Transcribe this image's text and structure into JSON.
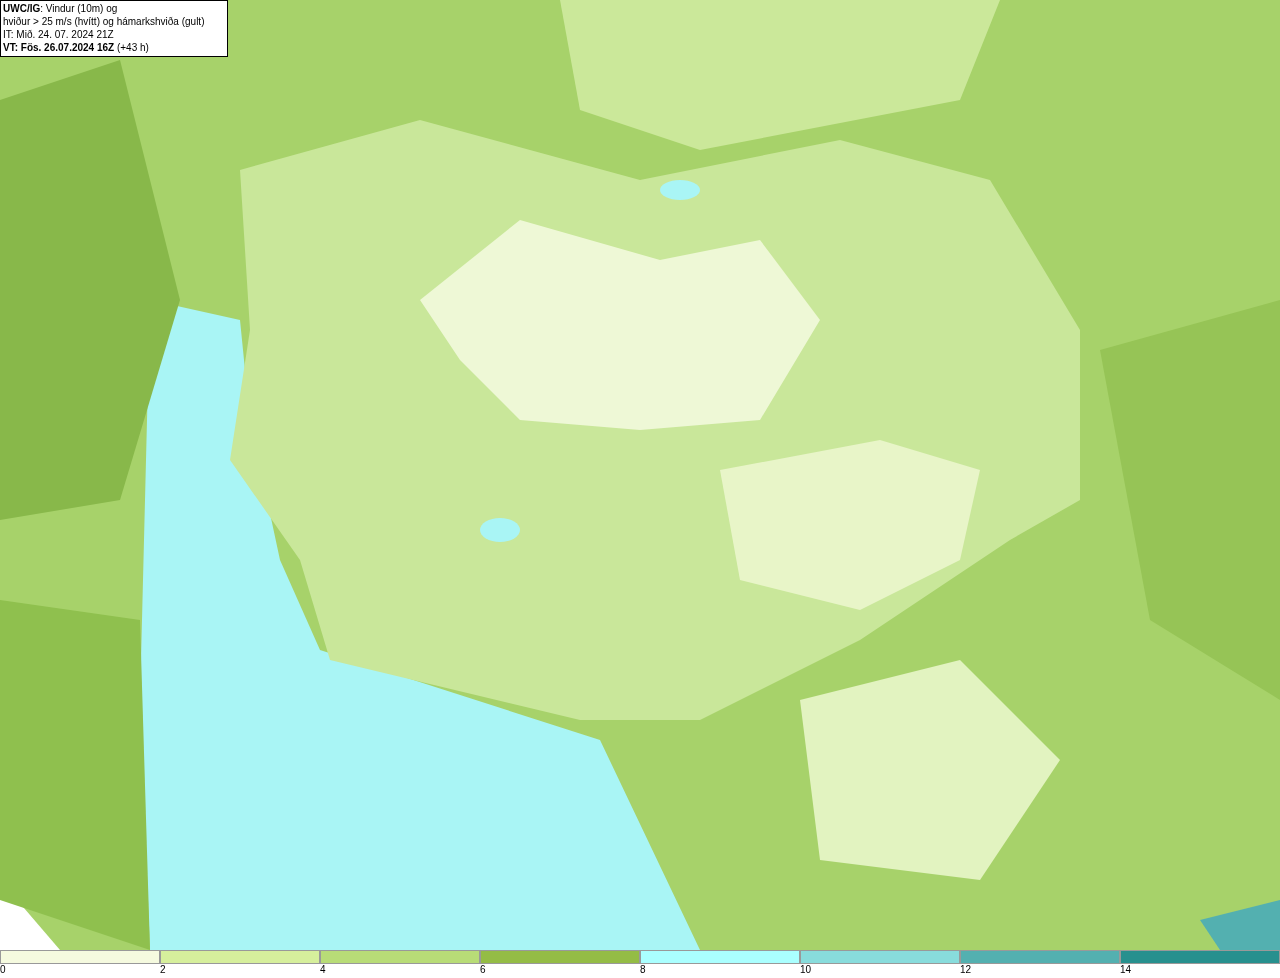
{
  "legend": {
    "lines": [
      "**UWC/IG**: Vindur (10m) og",
      "hviður > 25 m/s (hvítt) og hámarkshviða (gult)",
      "IT: Mið. 24. 07. 2024 21Z",
      "**VT: Fös. 26.07.2024 16Z** (+43 h)"
    ]
  },
  "colorbar": {
    "segments": [
      {
        "label": "0",
        "color": "#f5fadf"
      },
      {
        "label": "2",
        "color": "#d6ef9c"
      },
      {
        "label": "4",
        "color": "#b8dc77"
      },
      {
        "label": "6",
        "color": "#94bc45"
      },
      {
        "label": "8",
        "color": "#aaffff"
      },
      {
        "label": "10",
        "color": "#88dcdc"
      },
      {
        "label": "12",
        "color": "#53b0b0"
      },
      {
        "label": "14",
        "color": "#27908e"
      }
    ]
  }
}
